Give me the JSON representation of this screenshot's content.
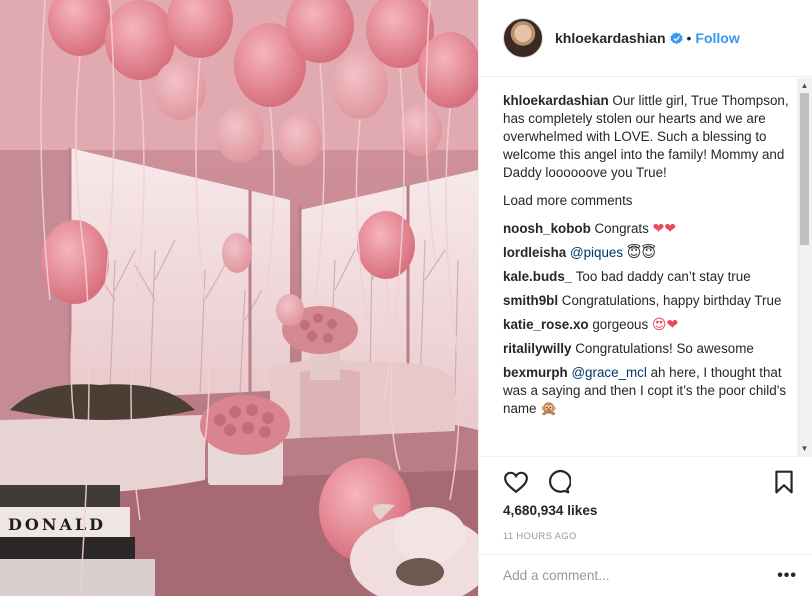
{
  "post": {
    "image_alt": "Pink balloons in a room with flowers and books",
    "book_title": "DONALD"
  },
  "header": {
    "username": "khloekardashian",
    "separator": "•",
    "follow_label": "Follow"
  },
  "caption": {
    "username": "khloekardashian",
    "text": "Our little girl, True Thompson, has completely stolen our hearts and we are overwhelmed with LOVE. Such a blessing to welcome this angel into the family! Mommy and Daddy loooooove you True!"
  },
  "load_more": "Load more comments",
  "comments": [
    {
      "user": "noosh_kobob",
      "text": "Congrats ",
      "emoji": "❤❤"
    },
    {
      "user": "lordleisha",
      "mention": "@piques",
      "text": " ",
      "emoji": "😇😇"
    },
    {
      "user": "kale.buds_",
      "text": "Too bad daddy can’t stay true",
      "emoji": ""
    },
    {
      "user": "smith9bl",
      "text": "Congratulations, happy birthday True",
      "emoji": ""
    },
    {
      "user": "katie_rose.xo",
      "text": "gorgeous ",
      "emoji": "😍❤"
    },
    {
      "user": "ritalilywilly",
      "text": "Congratulations! So awesome",
      "emoji": ""
    },
    {
      "user": "bexmurph",
      "mention": "@grace_mcl",
      "text": " ah here, I thought that was a saying and then I copt it’s the poor child’s name ",
      "emoji": "🙊"
    }
  ],
  "likes": "4,680,934 likes",
  "timestamp": "11 HOURS AGO",
  "add_comment_placeholder": "Add a comment...",
  "more_label": "•••",
  "colors": {
    "accent": "#3897f0",
    "text": "#262626",
    "muted": "#999999",
    "heart": "#ed4956"
  },
  "icons": [
    "heart-icon",
    "comment-icon",
    "bookmark-icon",
    "verified-badge-icon"
  ]
}
